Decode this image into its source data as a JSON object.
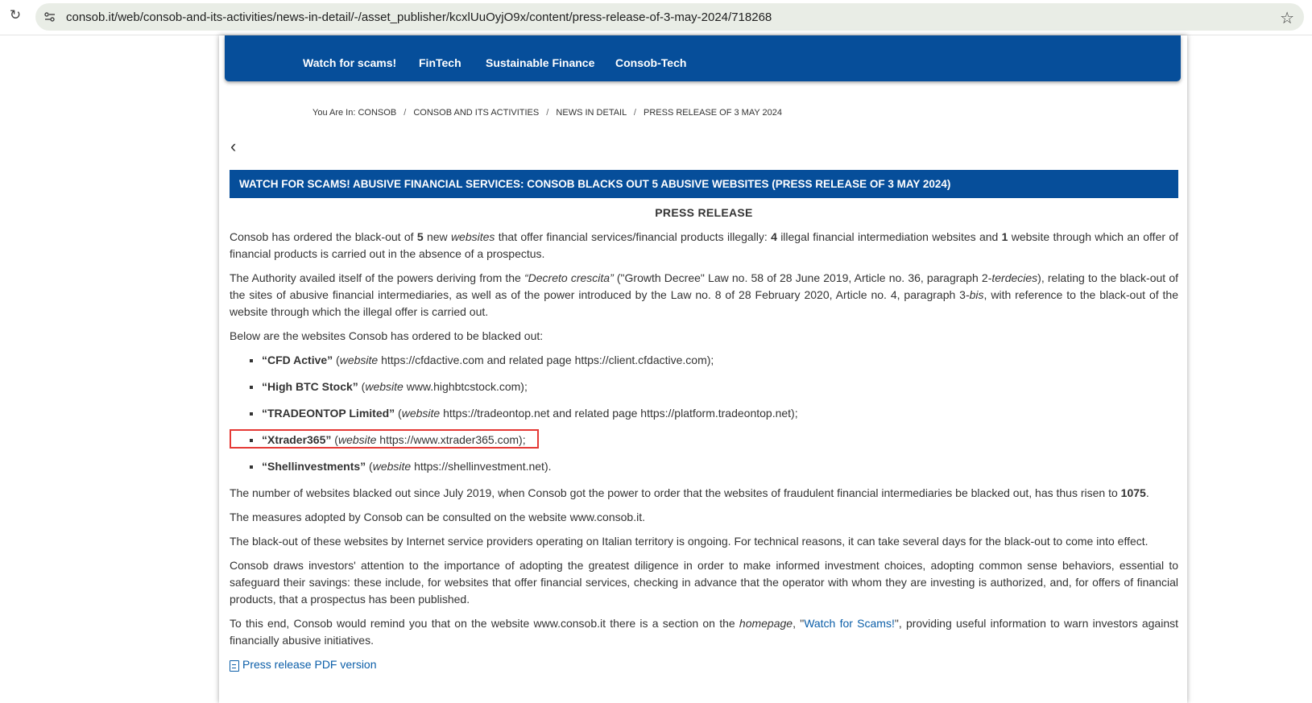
{
  "browser": {
    "url": "consob.it/web/consob-and-its-activities/news-in-detail/-/asset_publisher/kcxlUuOyjO9x/content/press-release-of-3-may-2024/718268"
  },
  "nav": {
    "items": [
      "Watch for scams!",
      "FinTech",
      "Sustainable Finance",
      "Consob-Tech"
    ]
  },
  "breadcrumb": {
    "prefix": "You Are In:",
    "items": [
      "CONSOB",
      "CONSOB AND ITS ACTIVITIES",
      "NEWS IN DETAIL",
      "PRESS RELEASE OF 3 MAY 2024"
    ]
  },
  "article": {
    "title": "WATCH FOR SCAMS! ABUSIVE FINANCIAL SERVICES: CONSOB BLACKS OUT 5 ABUSIVE WEBSITES (PRESS RELEASE OF 3 MAY 2024)",
    "heading": "PRESS RELEASE",
    "p1": {
      "a": "Consob has ordered the black-out of ",
      "b": "5",
      "c": " new ",
      "d": "websites",
      "e": " that offer financial services/financial products illegally: ",
      "f": "4",
      "g": " illegal financial intermediation websites and ",
      "h": "1",
      "i": " website through which an offer of financial products is carried out in the absence of a prospectus."
    },
    "p2": {
      "a": "The Authority availed itself of the powers deriving from the ",
      "b": "“Decreto crescita”",
      "c": " (\"Growth Decree\" Law no. 58 of 28 June 2019, Article no. 36, paragraph 2-",
      "d": "terdecies",
      "e": "), relating to the black-out of the sites of abusive financial intermediaries, as well as of the power introduced by the Law no. 8 of 28 February 2020, Article no. 4, paragraph 3-",
      "f": "bis",
      "g": ", with reference to the black-out of the website through which the illegal offer is carried out."
    },
    "p3": "Below are the websites Consob has ordered to be blacked out:",
    "sites": [
      {
        "name": "“CFD Active”",
        "pre": " (",
        "web": "website",
        "rest": " https://cfdactive.com and related page https://client.cfdactive.com);"
      },
      {
        "name": "“High BTC Stock”",
        "pre": " (",
        "web": "website",
        "rest": " www.highbtcstock.com);"
      },
      {
        "name": "“TRADEONTOP Limited”",
        "pre": " (",
        "web": "website",
        "rest": " https://tradeontop.net and related page https://platform.tradeontop.net);"
      },
      {
        "name": "“Xtrader365”",
        "pre": " (",
        "web": "website",
        "rest": " https://www.xtrader365.com);"
      },
      {
        "name": "“Shellinvestments”",
        "pre": " (",
        "web": "website",
        "rest": " https://shellinvestment.net)."
      }
    ],
    "p4": {
      "a": "The number of websites blacked out since July 2019, when Consob got the power to order that the websites of fraudulent financial intermediaries be blacked out, has thus risen to ",
      "b": "1075",
      "c": "."
    },
    "p5": "The measures adopted by Consob can be consulted on the website www.consob.it.",
    "p6": "The black-out of these websites by Internet service providers operating on Italian territory is ongoing. For technical reasons, it can take several days for the black-out to come into effect.",
    "p7": "Consob draws investors' attention to the importance of adopting the greatest diligence in order to make informed investment choices, adopting common sense behaviors, essential to safeguard their savings: these include, for websites that offer financial services, checking in advance that the operator with whom they are investing is authorized, and, for offers of financial products, that a prospectus has been published.",
    "p8": {
      "a": "To this end, Consob would remind you that on the website www.consob.it there is a section on the ",
      "b": "homepage",
      "c": ", \"",
      "d": "Watch for Scams!",
      "e": "\", providing useful information to warn investors against financially abusive initiatives."
    },
    "pdf_link": "Press release PDF version"
  },
  "icons": {
    "reload": "reload-icon",
    "site_info": "site-info-icon",
    "star": "bookmark-star-icon",
    "back": "back-arrow-icon",
    "pdf": "pdf-document-icon"
  },
  "colors": {
    "nav_bg": "#064e9a",
    "highlight_box": "#e53935",
    "link": "#0b5ea8"
  }
}
